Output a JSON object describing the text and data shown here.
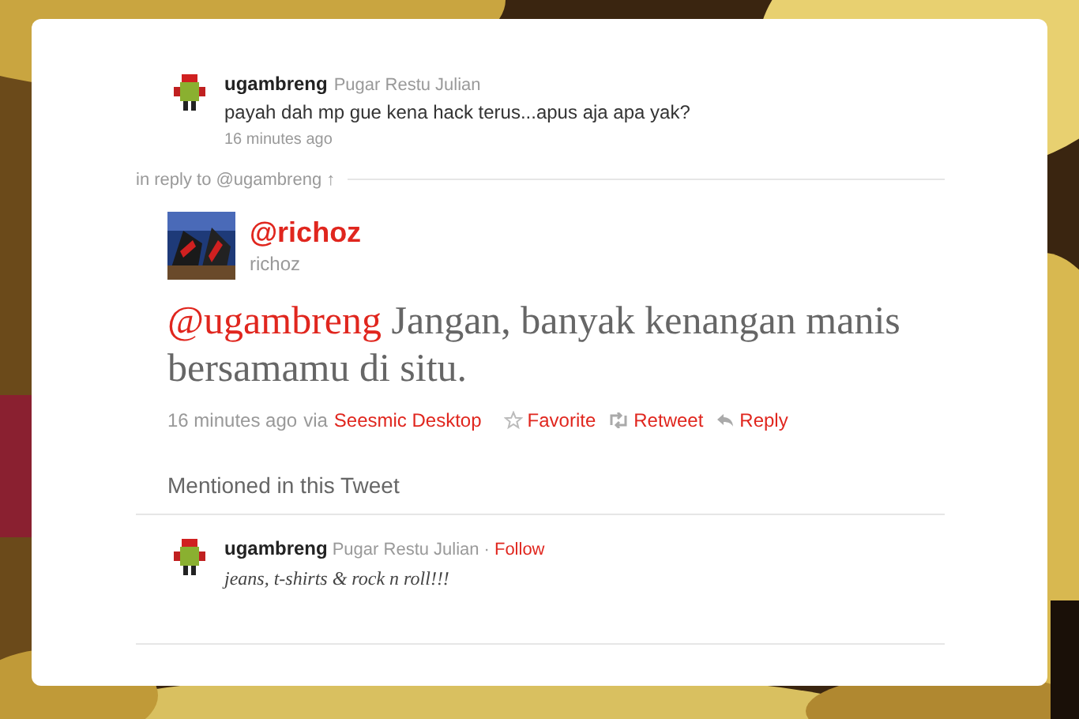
{
  "parent_tweet": {
    "username": "ugambreng",
    "full_name": "Pugar Restu Julian",
    "text": "payah dah mp gue kena hack terus...apus aja apa yak?",
    "time": "16 minutes ago"
  },
  "in_reply_to": "in reply to @ugambreng ↑",
  "tweet": {
    "handle": "@richoz",
    "name": "richoz",
    "mention": "@ugambreng",
    "text": "Jangan, banyak kenangan manis bersamamu di situ.",
    "time": "16 minutes ago",
    "via": "via",
    "source": "Seesmic Desktop",
    "actions": [
      {
        "kind": "favorite",
        "label": "Favorite"
      },
      {
        "kind": "retweet",
        "label": "Retweet"
      },
      {
        "kind": "reply",
        "label": "Reply"
      }
    ]
  },
  "mentioned": {
    "heading": "Mentioned in this Tweet",
    "users": [
      {
        "username": "ugambreng",
        "full_name": "Pugar Restu Julian",
        "separator": "·",
        "follow": "Follow",
        "bio": "jeans, t-shirts & rock n roll!!!"
      }
    ]
  }
}
